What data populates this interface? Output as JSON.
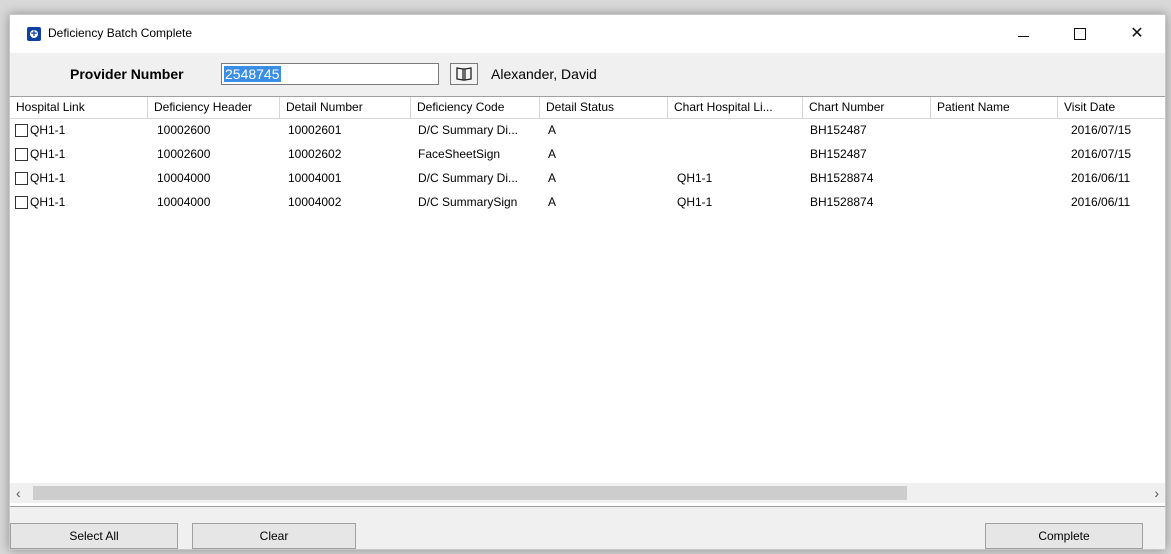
{
  "window": {
    "title": "Deficiency Batch Complete"
  },
  "provider": {
    "label": "Provider Number",
    "number": "2548745",
    "name": "Alexander, David"
  },
  "columns": [
    "Hospital Link",
    "Deficiency Header",
    "Detail Number",
    "Deficiency Code",
    "Detail Status",
    "Chart Hospital Li...",
    "Chart Number",
    "Patient Name",
    "Visit Date"
  ],
  "rows": [
    {
      "hospital_link": "QH1-1",
      "deficiency_header": "10002600",
      "detail_number": "10002601",
      "deficiency_code": "D/C Summary Di...",
      "detail_status": "A",
      "chart_hospital_link": "",
      "chart_number": "BH152487",
      "patient_name": "",
      "visit_date": "2016/07/15"
    },
    {
      "hospital_link": "QH1-1",
      "deficiency_header": "10002600",
      "detail_number": "10002602",
      "deficiency_code": "FaceSheetSign",
      "detail_status": "A",
      "chart_hospital_link": "",
      "chart_number": "BH152487",
      "patient_name": "",
      "visit_date": "2016/07/15"
    },
    {
      "hospital_link": "QH1-1",
      "deficiency_header": "10004000",
      "detail_number": "10004001",
      "deficiency_code": "D/C Summary Di...",
      "detail_status": "A",
      "chart_hospital_link": "QH1-1",
      "chart_number": "BH1528874",
      "patient_name": "",
      "visit_date": "2016/06/11"
    },
    {
      "hospital_link": "QH1-1",
      "deficiency_header": "10004000",
      "detail_number": "10004002",
      "deficiency_code": "D/C SummarySign",
      "detail_status": "A",
      "chart_hospital_link": "QH1-1",
      "chart_number": "BH1528874",
      "patient_name": "",
      "visit_date": "2016/06/11"
    }
  ],
  "buttons": {
    "select_all": "Select All",
    "clear": "Clear",
    "complete": "Complete"
  },
  "icons": {
    "app": "app-plus-icon",
    "lookup": "book-lookup-icon",
    "scroll_left": "chevron-left-icon",
    "scroll_right": "chevron-right-icon"
  },
  "colors": {
    "selection": "#3a8ee6",
    "app_icon": "#0f3fa3"
  }
}
